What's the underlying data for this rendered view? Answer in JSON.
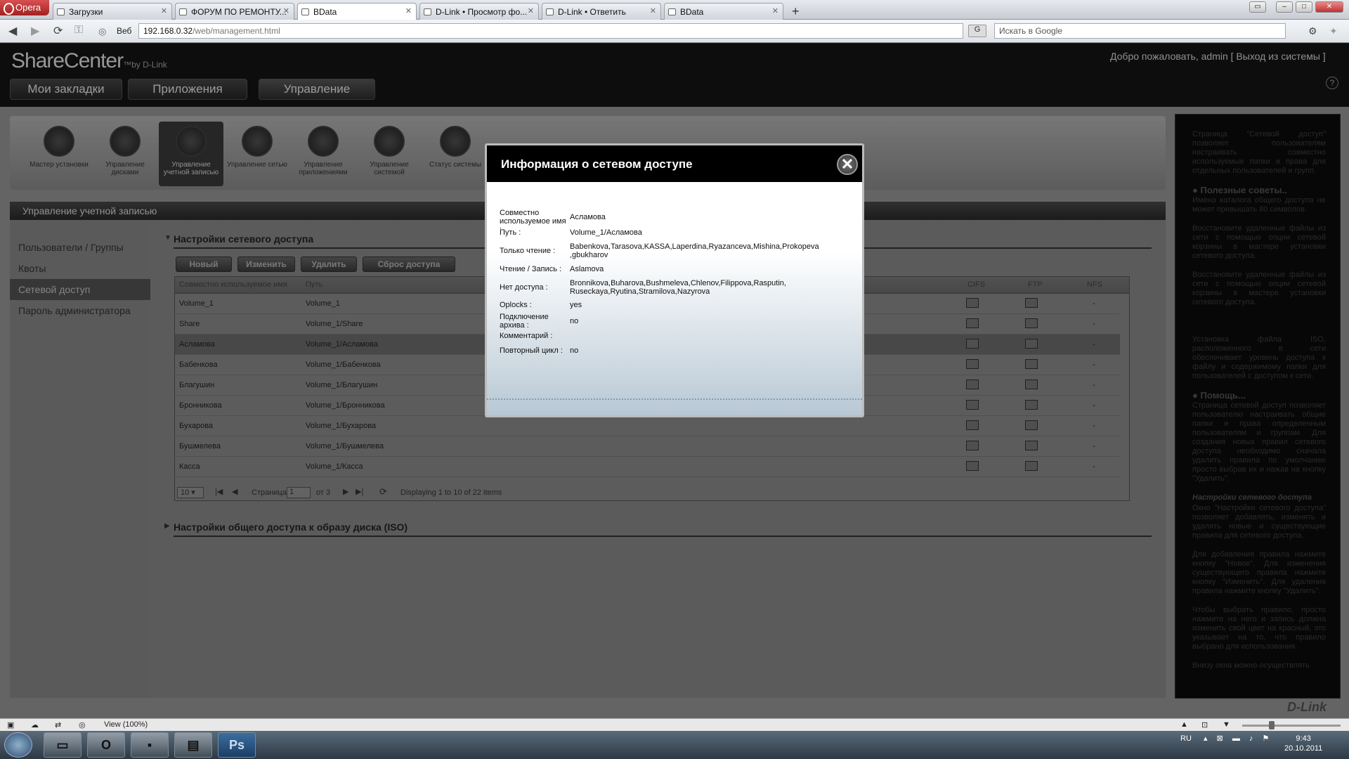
{
  "browser": {
    "menu_label": "Opera",
    "tabs": [
      {
        "label": "Загрузки"
      },
      {
        "label": "ФОРУМ ПО РЕМОНТУ..."
      },
      {
        "label": "BData"
      },
      {
        "label": "D-Link • Просмотр фо..."
      },
      {
        "label": "D-Link • Ответить"
      },
      {
        "label": "BData"
      }
    ],
    "web_label": "Веб",
    "url_host": "192.168.0.32",
    "url_path": "/web/management.html",
    "search_placeholder": "Искать в Google",
    "google_label": "G"
  },
  "app": {
    "logo": "ShareCenter",
    "logo_sub": "™by D-Link",
    "welcome": "Добро пожаловать, admin [ Выход из системы ]",
    "main_nav": [
      "Мои закладки",
      "Приложения",
      "Управление"
    ],
    "tools": [
      {
        "label": "Мастер установки"
      },
      {
        "label": "Управление дисками"
      },
      {
        "label": "Управление учетной записью"
      },
      {
        "label": "Управление сетью"
      },
      {
        "label": "Управление приложениями"
      },
      {
        "label": "Управление системой"
      },
      {
        "label": "Статус системы"
      }
    ],
    "section_title": "Управление учетной записью",
    "left_menu": [
      "Пользователи / Группы",
      "Квоты",
      "Сетевой доступ",
      "Пароль администратора"
    ],
    "net_section": "Настройки сетевого доступа",
    "iso_section": "Настройки общего доступа к образу диска (ISO)",
    "buttons": [
      "Новый",
      "Изменить",
      "Удалить",
      "Сброс доступа"
    ],
    "grid_headers": [
      "Совместно используемое имя",
      "Путь",
      "CIFS",
      "FTP",
      "NFS"
    ],
    "grid_rows": [
      {
        "name": "Volume_1",
        "path": "Volume_1"
      },
      {
        "name": "Share",
        "path": "Volume_1/Share"
      },
      {
        "name": "Асламова",
        "path": "Volume_1/Асламова"
      },
      {
        "name": "Бабенкова",
        "path": "Volume_1/Бабенкова"
      },
      {
        "name": "Благушин",
        "path": "Volume_1/Благушин"
      },
      {
        "name": "Бронникова",
        "path": "Volume_1/Бронникова"
      },
      {
        "name": "Бухарова",
        "path": "Volume_1/Бухарова"
      },
      {
        "name": "Бушмелева",
        "path": "Volume_1/Бушмелева"
      },
      {
        "name": "Касса",
        "path": "Volume_1/Касса"
      }
    ],
    "nfs_dash": "-",
    "pager": {
      "page_size": "10",
      "page_label": "Страница",
      "page": "1",
      "of_label": "от 3",
      "info": "Displaying 1 to 10 of 22 items"
    }
  },
  "help": {
    "intro": "Страница \"Сетевой доступ\" позволяет пользователям настраивать совместно используемые папки и права для отдельных пользователей и групп.",
    "tips_title": "Полезные советы..",
    "tip1": "Имена каталога общего доступа не может превышать 80 символов.",
    "tip2": "Восстановите удаленные файлы из сети с помощью опции сетевой корзины в мастере установки сетевого доступа.",
    "tip3": "Восстановите удаленные файлы из сети с помощью опции сетевой корзины в мастере установки сетевого доступа.",
    "tip4": "Установка файла ISO, расположенного в сети обеспечивает уровень доступа к файлу и содержимому папки для пользователей с доступом к сети.",
    "help_title": "Помощь...",
    "help1": "Страница сетевой доступ позволяет пользователю настраивать общие папки и права определенным пользователям и группам. Для создания новых правил сетевого доступа необходимо сначала удалить правила по умолчанию просто выбрав их и нажав на кнопку \"Удалить\".",
    "net_title": "Настройки сетевого доступа",
    "net1": "Окно \"Настройки сетевого доступа\" позволяет добавлять, изменять и удалять новые и существующие правила для сетевого доступа.",
    "net2": "Для добавления правила нажмите кнопку \"Новое\". Для изменения существующего правила нажмите кнопку \"Изменить\". Для удаления правила нажмите кнопку \"Удалить\".",
    "net3": "Чтобы выбрать правило, просто нажмите на него и запись должна изменить свой цвет на красный, это указывает на то, что правило выбрано для использования.",
    "net4": "Внизу окна можно осуществлять",
    "brand": "D-Link"
  },
  "modal": {
    "title": "Информация о сетевом доступе",
    "fields": [
      {
        "label": "Совместно используемое имя :",
        "value": "Асламова"
      },
      {
        "label": "Путь :",
        "value": "Volume_1/Асламова"
      },
      {
        "label": "Только чтение :",
        "value": "Babenkova,Tarasova,KASSA,Laperdina,Ryazanceva,Mishina,Prokopeva ,gbukharov"
      },
      {
        "label": "Чтение / Запись :",
        "value": "Aslamova"
      },
      {
        "label": "Нет доступа :",
        "value": "Bronnikova,Buharova,Bushmeleva,Chlenov,Filippova,Rasputin, Ruseckaya,Ryutina,Stramilova,Nazyrova"
      },
      {
        "label": "Oplocks :",
        "value": "yes"
      },
      {
        "label": "Подключение архива :",
        "value": "no"
      },
      {
        "label": "Комментарий :",
        "value": ""
      },
      {
        "label": "Повторный цикл :",
        "value": "no"
      }
    ]
  },
  "statusbar": {
    "view": "View (100%)"
  },
  "taskbar": {
    "lang": "RU",
    "time": "9:43",
    "date": "20.10.2011",
    "ps_label": "Ps",
    "opera_label": "O"
  }
}
